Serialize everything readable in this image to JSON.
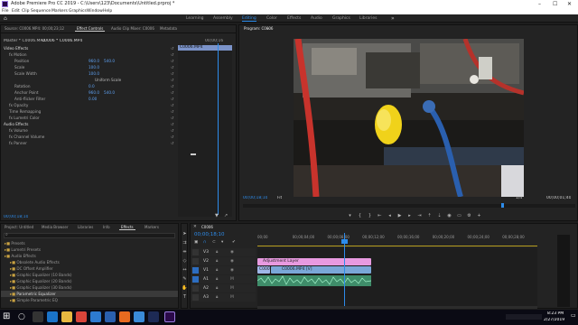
{
  "window": {
    "title": "Adobe Premiere Pro CC 2019 - C:\\Users\\123\\Documents\\Untitled.prproj *",
    "min": "–",
    "max": "☐",
    "close": "✕"
  },
  "menu": [
    "File",
    "Edit",
    "Clip",
    "Sequence",
    "Markers",
    "Graphics",
    "Window",
    "Help"
  ],
  "workspaces": [
    "Learning",
    "Assembly",
    "Editing",
    "Color",
    "Effects",
    "Audio",
    "Graphics",
    "Libraries"
  ],
  "workspaces_active": "Editing",
  "source_panel": {
    "tabs": [
      "Source: C0006.MP4: 00;00;23;12",
      "Effect Controls",
      "Audio Clip Mixer: C0006",
      "Metadata"
    ],
    "header": [
      "Master * C0006.MP4",
      "C0006 * C0006.MP4"
    ],
    "timecode_start": "00;00;16",
    "clip_label": "C0006.MP4",
    "rows": [
      {
        "label": "Video Effects",
        "indent": 0,
        "values": []
      },
      {
        "label": "fx  Motion",
        "indent": 1,
        "values": []
      },
      {
        "label": "Position",
        "indent": 2,
        "values": [
          "960.0",
          "540.0"
        ]
      },
      {
        "label": "Scale",
        "indent": 2,
        "values": [
          "100.0"
        ]
      },
      {
        "label": "Scale Width",
        "indent": 2,
        "values": [
          "100.0"
        ]
      },
      {
        "label": "",
        "indent": 2,
        "values": [
          "Uniform Scale"
        ]
      },
      {
        "label": "Rotation",
        "indent": 2,
        "values": [
          "0.0"
        ]
      },
      {
        "label": "Anchor Point",
        "indent": 2,
        "values": [
          "960.0",
          "540.0"
        ]
      },
      {
        "label": "Anti-flicker Filter",
        "indent": 2,
        "values": [
          "0.00"
        ]
      },
      {
        "label": "fx  Opacity",
        "indent": 1,
        "values": []
      },
      {
        "label": "Time Remapping",
        "indent": 1,
        "values": []
      },
      {
        "label": "fx  Lumetri Color",
        "indent": 1,
        "values": []
      },
      {
        "label": "Audio Effects",
        "indent": 0,
        "values": []
      },
      {
        "label": "fx  Volume",
        "indent": 1,
        "values": []
      },
      {
        "label": "fx  Channel Volume",
        "indent": 1,
        "values": []
      },
      {
        "label": "fx  Panner",
        "indent": 1,
        "values": []
      }
    ],
    "footer_timecode": "00;00;18;10"
  },
  "program_panel": {
    "title": "Program: C0006",
    "timecode": "00;00;18;10",
    "fit": "Fit",
    "quality": "1/4",
    "duration": "00;00;01;40",
    "controls": [
      "marker",
      "in",
      "out",
      "go-in",
      "step-back",
      "play",
      "step-forward",
      "go-out",
      "lift",
      "extract",
      "export-frame",
      "compare",
      "settings",
      "add"
    ]
  },
  "project_panel": {
    "tabs": [
      "Project: Untitled",
      "Media Browser",
      "Libraries",
      "Info",
      "Effects",
      "Markers"
    ],
    "active_tab": "Effects",
    "items": [
      {
        "label": "Presets",
        "indent": 0
      },
      {
        "label": "Lumetri Presets",
        "indent": 0
      },
      {
        "label": "Audio Effects",
        "indent": 0
      },
      {
        "label": "Obsolete Audio Effects",
        "indent": 1
      },
      {
        "label": "DC Offset Amplifier",
        "indent": 1
      },
      {
        "label": "Graphic Equalizer (10 Bands)",
        "indent": 1
      },
      {
        "label": "Graphic Equalizer (20 Bands)",
        "indent": 1
      },
      {
        "label": "Graphic Equalizer (30 Bands)",
        "indent": 1
      },
      {
        "label": "Parametric Equalizer",
        "indent": 1
      },
      {
        "label": "Simple Parametric EQ",
        "indent": 1
      }
    ]
  },
  "timeline": {
    "tab": "C0006",
    "timecode": "00;00;18;10",
    "ruler": [
      "00;00",
      "00;00;04;00",
      "00;00;08;00",
      "00;00;12;00",
      "00;00;16;00",
      "00;00;20;00",
      "00;00;24;00",
      "00;00;28;00"
    ],
    "tracks": [
      "V3",
      "V2",
      "V1",
      "A1",
      "A2",
      "A3"
    ],
    "clips": {
      "adjustment": "Adjustment Layer",
      "v1a": "C000",
      "v1b": "C0006.MP4 [V]"
    }
  },
  "taskbar": {
    "time": "8:23 PM",
    "date": "2/27/2019"
  },
  "colors": {
    "accent": "#2d8ceb",
    "clip_pink": "#e89ae0",
    "clip_blue": "#7aa7d8",
    "audio_green": "#3f8d6a"
  }
}
